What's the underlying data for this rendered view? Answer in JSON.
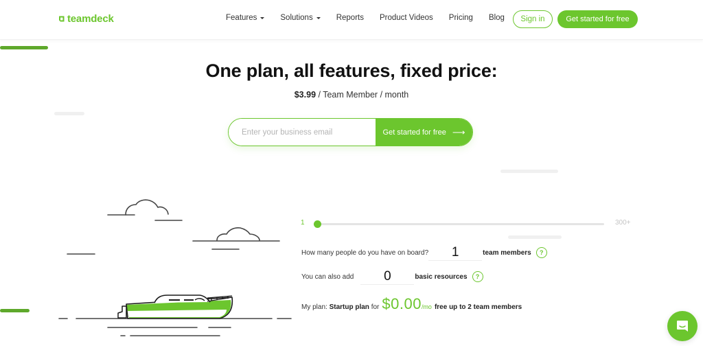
{
  "header": {
    "logo_text": "teamdeck",
    "nav": [
      {
        "label": "Features",
        "has_dropdown": true
      },
      {
        "label": "Solutions",
        "has_dropdown": true
      },
      {
        "label": "Reports",
        "has_dropdown": false
      },
      {
        "label": "Product Videos",
        "has_dropdown": false
      },
      {
        "label": "Pricing",
        "has_dropdown": false
      },
      {
        "label": "Blog",
        "has_dropdown": false
      }
    ],
    "sign_in_label": "Sign in",
    "get_started_label": "Get started for free"
  },
  "hero": {
    "title": "One plan, all features, fixed price:",
    "price": "$3.99",
    "price_suffix": " / Team Member / month"
  },
  "email_form": {
    "placeholder": "Enter your business email",
    "value": "",
    "submit_label": "Get started for free",
    "submit_icon": "arrow-right-icon",
    "arrow_glyph": "⟶"
  },
  "calculator": {
    "slider": {
      "min_label": "1",
      "max_label": "300+",
      "value_fraction": 0.0
    },
    "team_question": "How many people do you have on board?",
    "team_value": "1",
    "team_unit": "team members",
    "resources_question": "You can also add",
    "resources_value": "0",
    "resources_unit": "basic resources",
    "help_glyph": "?",
    "plan_prefix": "My plan:",
    "plan_name": "Startup plan",
    "plan_for": "for",
    "plan_price": "$0.00",
    "plan_period": "/mo",
    "plan_note": "free up to 2 team members"
  },
  "colors": {
    "brand": "#6cc62e",
    "brand_dark": "#5ea82b",
    "text": "#1a1a1a",
    "muted": "#b4b4b4"
  },
  "chat_widget": {
    "icon": "chat-bubble-icon"
  }
}
